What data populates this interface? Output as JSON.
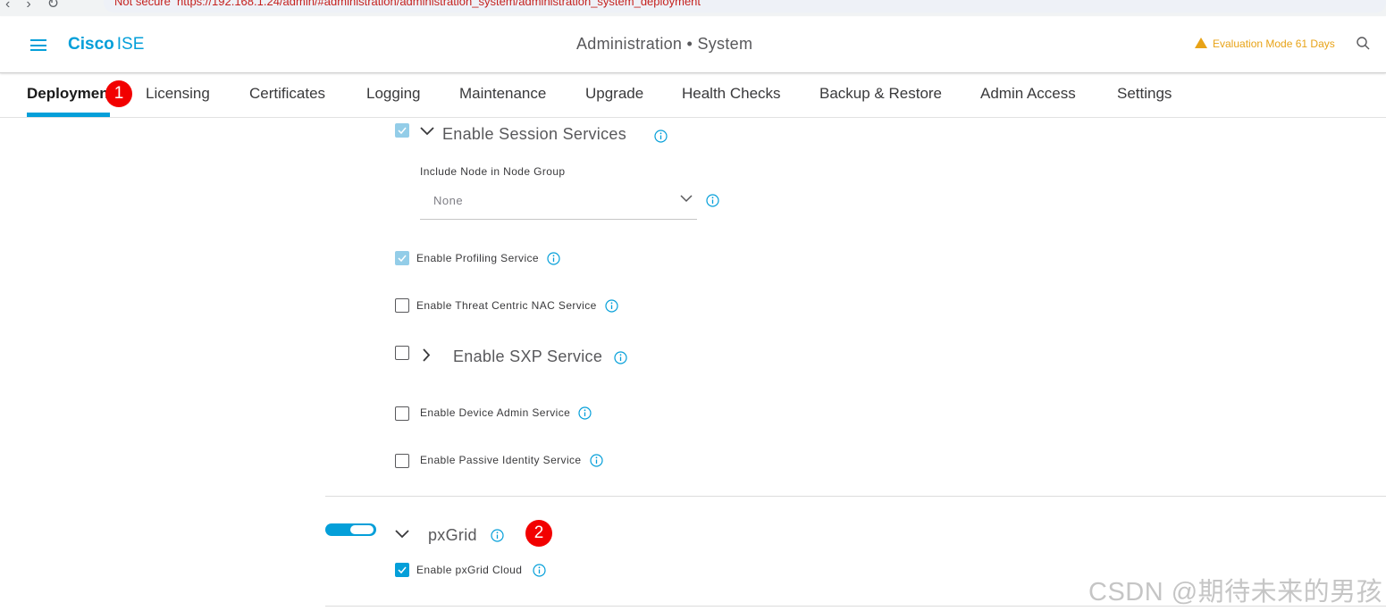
{
  "browser": {
    "security_text": "Not secure",
    "url_text": "https://192.168.1.24/admin/#administration/administration_system/administration_system_deployment"
  },
  "header": {
    "brand_bold": "Cisco",
    "brand_light": "ISE",
    "title": "Administration • System",
    "evaluation_notice": "Evaluation Mode 61 Days"
  },
  "tabs": [
    {
      "label": "Deploymen",
      "active": true
    },
    {
      "label": "Licensing"
    },
    {
      "label": "Certificates"
    },
    {
      "label": "Logging"
    },
    {
      "label": "Maintenance"
    },
    {
      "label": "Upgrade"
    },
    {
      "label": "Health Checks"
    },
    {
      "label": "Backup & Restore"
    },
    {
      "label": "Admin Access"
    },
    {
      "label": "Settings"
    }
  ],
  "badges": [
    "1",
    "2"
  ],
  "services": {
    "session": {
      "label": "Enable Session Services",
      "checked": true,
      "disabled": true,
      "expanded": true
    },
    "node_group": {
      "label": "Include Node in Node Group",
      "value": "None"
    },
    "profiling": {
      "label": "Enable Profiling Service",
      "checked": true,
      "disabled": true
    },
    "threat": {
      "label": "Enable Threat Centric NAC Service",
      "checked": false
    },
    "sxp": {
      "label": "Enable SXP Service",
      "checked": false,
      "expanded": false
    },
    "device_admin": {
      "label": "Enable Device Admin Service",
      "checked": false
    },
    "passive_identity": {
      "label": "Enable Passive Identity Service",
      "checked": false
    }
  },
  "pxgrid": {
    "label": "pxGrid",
    "enabled": true,
    "cloud_label": "Enable pxGrid Cloud",
    "cloud_checked": true
  },
  "watermark": "CSDN @期待未来的男孩",
  "colors": {
    "accent": "#049fd9",
    "warning": "#e8a317",
    "badge": "#f20000"
  }
}
